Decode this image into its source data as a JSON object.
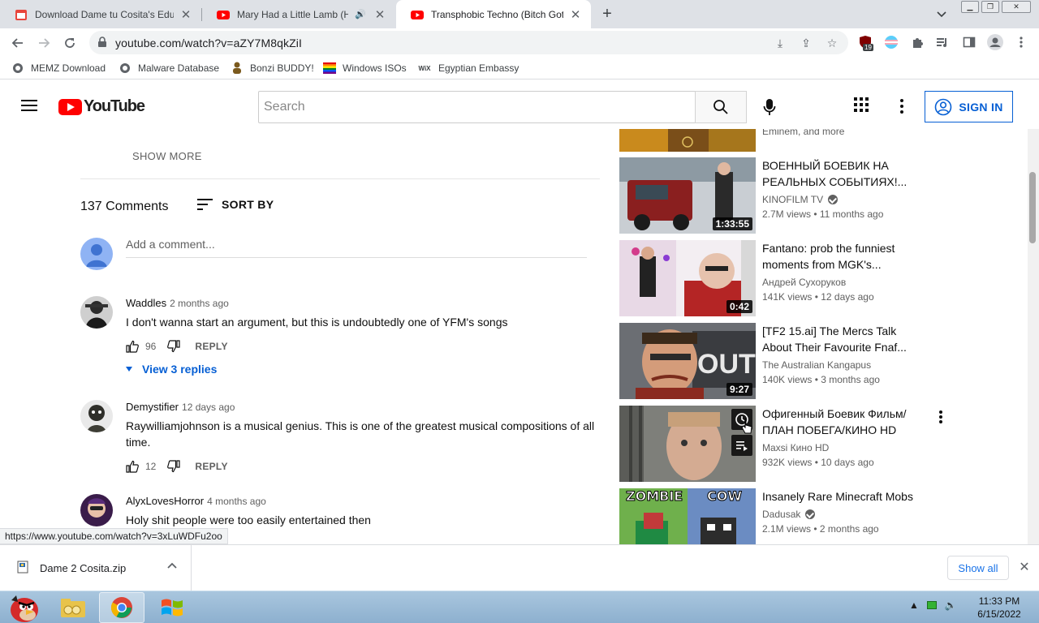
{
  "browser": {
    "tabs": [
      {
        "title": "Download Dame tu Cosita's Educ",
        "active": false,
        "favicon": "calendar-icon"
      },
      {
        "title": "Mary Had a Little Lamb (His",
        "active": false,
        "favicon": "youtube-icon",
        "audio": true
      },
      {
        "title": "Transphobic Techno (Bitch Got A",
        "active": true,
        "favicon": "youtube-icon"
      }
    ],
    "url": "youtube.com/watch?v=aZY7M8qkZiI",
    "extension_badge": "19",
    "bookmarks": [
      {
        "label": "MEMZ Download",
        "icon": "globe-icon"
      },
      {
        "label": "Malware Database",
        "icon": "globe-icon"
      },
      {
        "label": "Bonzi BUDDY!",
        "icon": "bonzi-icon"
      },
      {
        "label": "Windows ISOs",
        "icon": "rainbow-flag-icon"
      },
      {
        "label": "Egyptian Embassy",
        "icon": "wix-icon"
      }
    ],
    "status_url": "https://www.youtube.com/watch?v=3xLuWDFu2oo"
  },
  "youtube": {
    "logo_text": "YouTube",
    "search_placeholder": "Search",
    "signin_label": "SIGN IN",
    "show_more": "SHOW MORE",
    "comments_count": "137 Comments",
    "sort_by": "SORT BY",
    "add_comment": "Add a comment...",
    "reply_label": "REPLY",
    "comments": [
      {
        "author": "Waddles",
        "time": "2 months ago",
        "text": "I don't wanna start an argument, but this is undoubtedly one of YFM's songs",
        "likes": "96",
        "view_replies": "View 3 replies"
      },
      {
        "author": "Demystifier",
        "time": "12 days ago",
        "text": "Raywilliamjohnson is a musical genius. This is one of the greatest musical compositions of all time.",
        "likes": "12"
      },
      {
        "author": "AlyxLovesHorror",
        "time": "4 months ago",
        "text": "Holy shit people were too easily entertained then"
      }
    ],
    "related": [
      {
        "title": "",
        "channel": "Eminem, and more",
        "meta": "",
        "duration": ""
      },
      {
        "title": "ВОЕННЫЙ БОЕВИК НА РЕАЛЬНЫХ СОБЫТИЯХ!...",
        "channel": "KINOFILM TV",
        "verified": true,
        "meta": "2.7M views • 11 months ago",
        "duration": "1:33:55"
      },
      {
        "title": "Fantano: prob the funniest moments from MGK's...",
        "channel": "Андрей Сухоруков",
        "verified": false,
        "meta": "141K views • 12 days ago",
        "duration": "0:42"
      },
      {
        "title": "[TF2 15.ai] The Mercs Talk About Their Favourite Fnaf...",
        "channel": "The Australian Kangapus",
        "verified": false,
        "meta": "140K views • 3 months ago",
        "duration": "9:27"
      },
      {
        "title": "Офигенный Боевик Фильм/ ПЛАН ПОБЕГА/КИНО HD",
        "channel": "Maxsi Кино HD",
        "verified": false,
        "meta": "932K views • 10 days ago",
        "duration": ""
      },
      {
        "title": "Insanely Rare Minecraft Mobs",
        "channel": "Dadusak",
        "verified": true,
        "meta": "2.1M views • 2 months ago",
        "duration": "",
        "thumb_left": "ZOMBIE",
        "thumb_right": "COW"
      }
    ]
  },
  "download_shelf": {
    "file_name": "Dame 2 Cosita.zip",
    "show_all": "Show all"
  },
  "taskbar": {
    "time": "11:33 PM",
    "date": "6/15/2022"
  }
}
